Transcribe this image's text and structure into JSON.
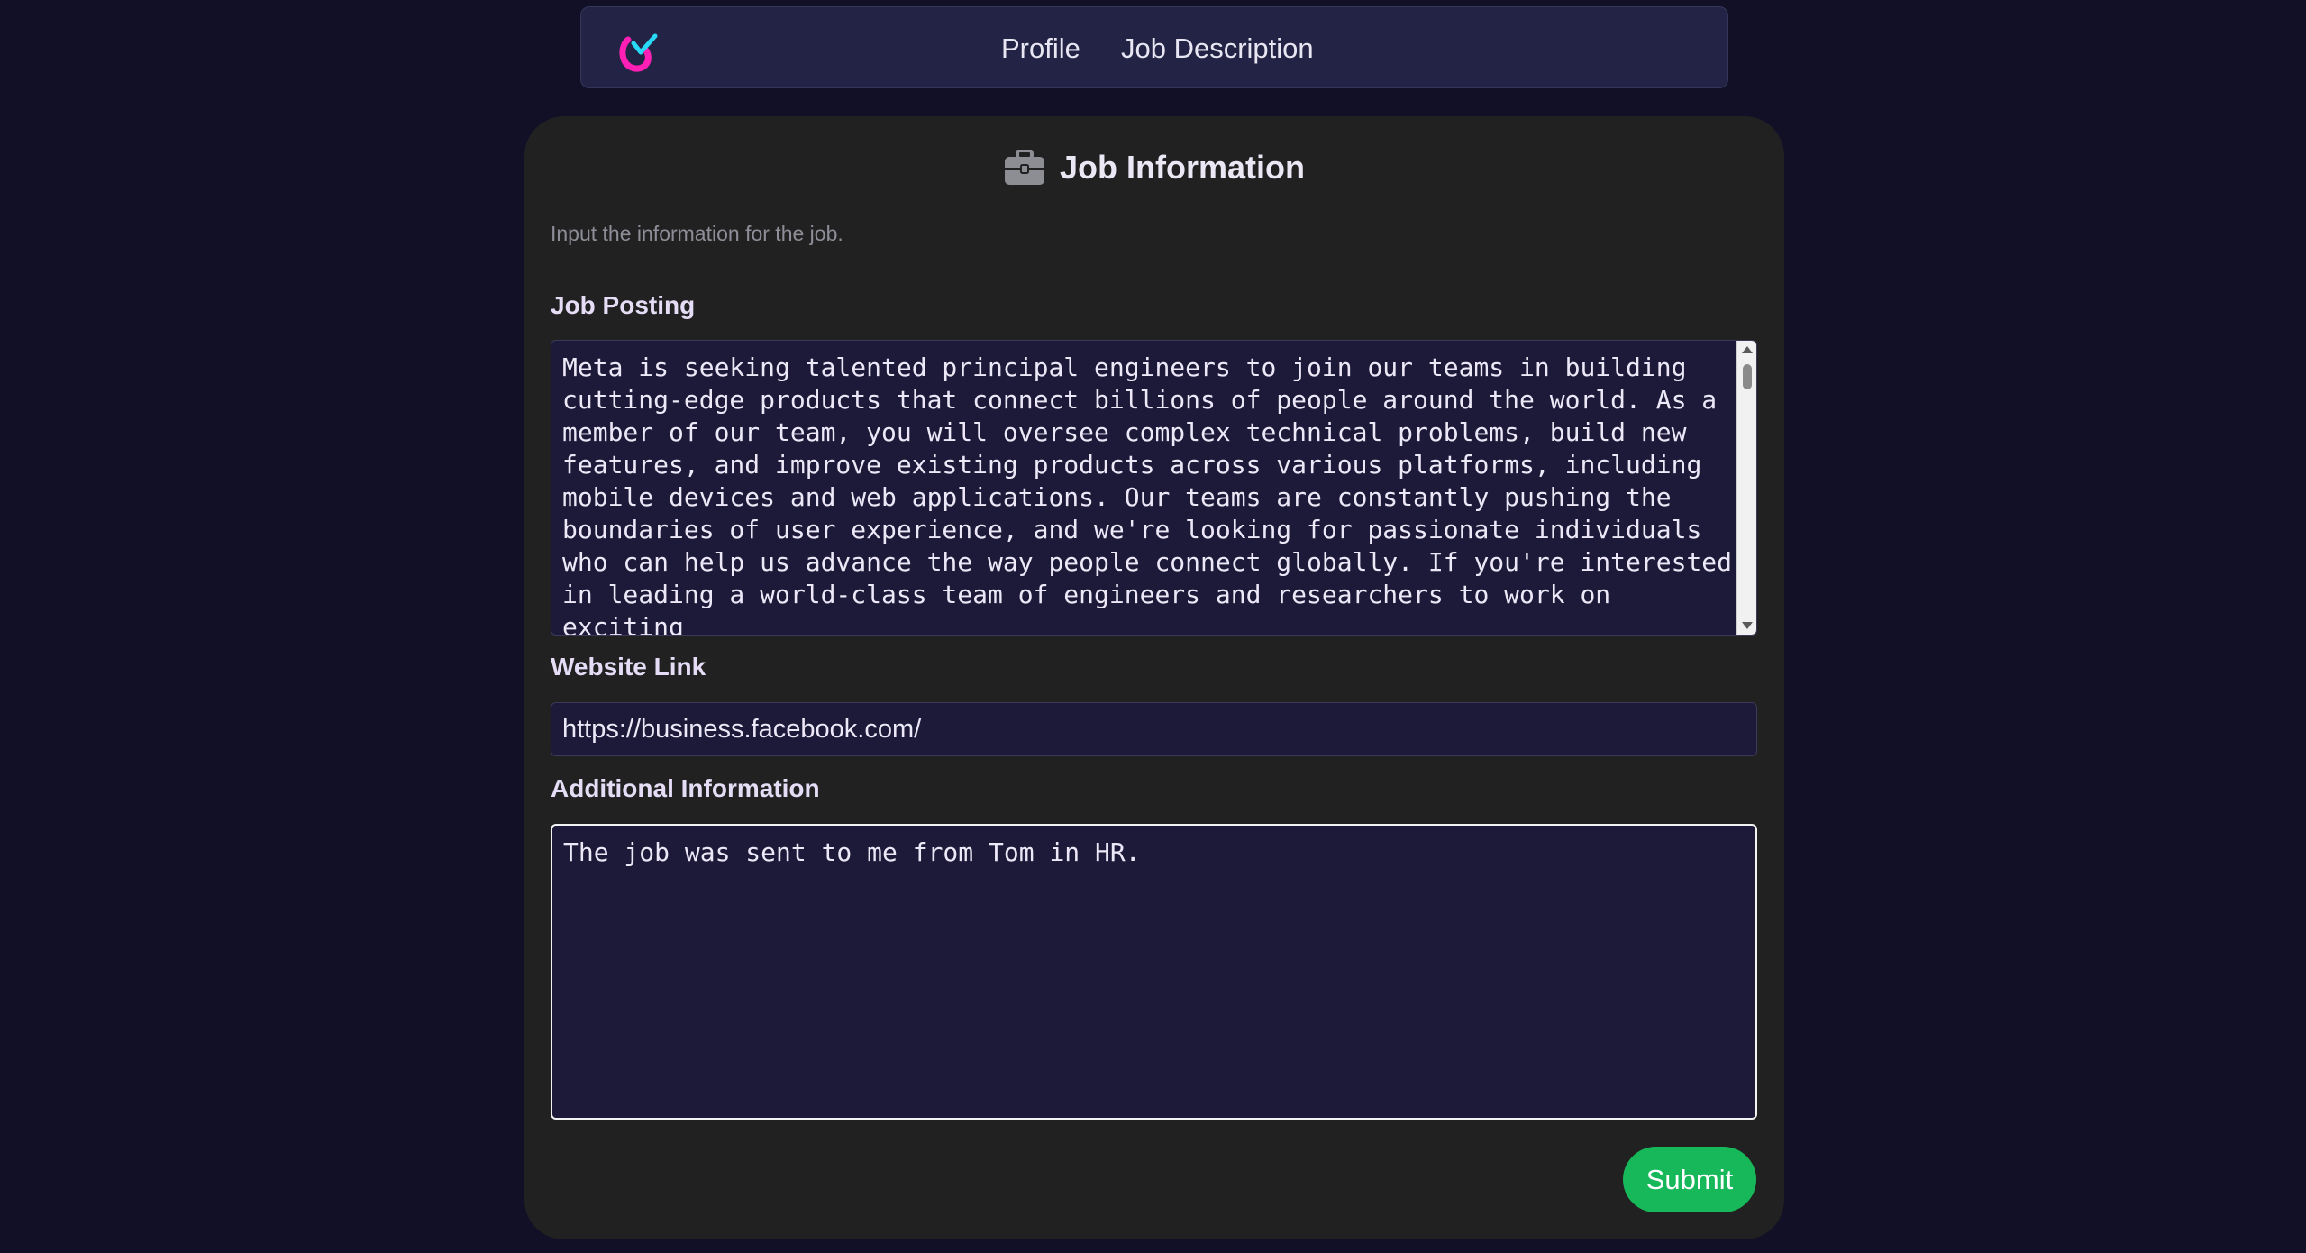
{
  "nav": {
    "logo_icon": "brand-logo-icon",
    "links": [
      {
        "label": "Profile"
      },
      {
        "label": "Job Description"
      }
    ]
  },
  "card": {
    "icon": "briefcase-icon",
    "title": "Job Information",
    "subtitle": "Input the information for the job."
  },
  "form": {
    "job_posting": {
      "label": "Job Posting",
      "value": "Meta is seeking talented principal engineers to join our teams in building\ncutting-edge products that connect billions of people around the world. As a\nmember of our team, you will oversee complex technical problems, build new\nfeatures, and improve existing products across various platforms, including\nmobile devices and web applications. Our teams are constantly pushing the\nboundaries of user experience, and we're looking for passionate individuals\nwho can help us advance the way people connect globally. If you're interested\nin leading a world-class team of engineers and researchers to work on exciting\nprojects that have significant impact, we encourage you to apply."
    },
    "website_link": {
      "label": "Website Link",
      "value": "https://business.facebook.com/"
    },
    "additional_info": {
      "label": "Additional Information",
      "value": "The job was sent to me from Tom in HR."
    },
    "submit_label": "Submit"
  },
  "colors": {
    "page_bg": "#121026",
    "navbar_bg": "#232445",
    "card_bg": "#212121",
    "field_bg": "#1c1a38",
    "submit_bg": "#17b85a",
    "logo_magenta": "#ff1fb4",
    "logo_cyan": "#28d8f5"
  }
}
